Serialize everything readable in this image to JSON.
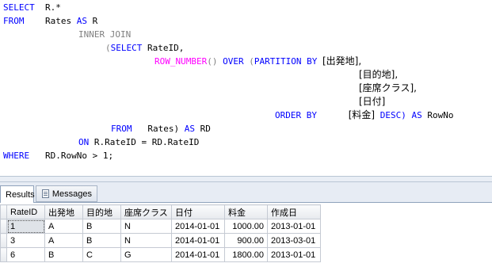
{
  "query": {
    "select_kw": "SELECT",
    "select_expr": "R.*",
    "from_kw": "FROM",
    "from_table": "Rates",
    "as_kw": "AS",
    "alias_r": "R",
    "inner_join": "INNER JOIN",
    "open_paren": "(",
    "select2_kw": "SELECT",
    "rateid_col": "RateID,",
    "row_number_fn": "ROW_NUMBER",
    "fn_parens": "()",
    "over_kw": "OVER",
    "partition_by_kw": "PARTITION BY",
    "partition_cols": [
      "[出発地],",
      "[目的地],",
      "[座席クラス],",
      "[日付]"
    ],
    "order_by_kw": "ORDER BY",
    "order_col": "[料金]",
    "desc_kw": "DESC)",
    "as2_kw": "AS",
    "rowno_alias": "RowNo",
    "from2_kw": "FROM",
    "rates2_table": "Rates)",
    "as3_kw": "AS",
    "rd_alias": "RD",
    "on_kw": "ON",
    "on_expr": "R.RateID = RD.RateID",
    "where_kw": "WHERE",
    "where_expr": "RD.RowNo > 1;"
  },
  "tabs": {
    "results_label": "Results",
    "messages_label": "Messages",
    "messages_icon": "messages-icon"
  },
  "grid": {
    "columns": [
      "RateID",
      "出発地",
      "目的地",
      "座席クラス",
      "日付",
      "料金",
      "作成日"
    ],
    "rows": [
      {
        "rownum": "",
        "cells": [
          "1",
          "A",
          "B",
          "N",
          "2014-01-01",
          "1000.00",
          "2013-01-01"
        ]
      },
      {
        "rownum": "",
        "cells": [
          "3",
          "A",
          "B",
          "N",
          "2014-01-01",
          "900.00",
          "2013-03-01"
        ]
      },
      {
        "rownum": "",
        "cells": [
          "6",
          "B",
          "C",
          "G",
          "2014-01-01",
          "1800.00",
          "2013-01-01"
        ]
      }
    ]
  },
  "colors": {
    "keyword": "#0000ff",
    "function": "#ff00ff",
    "operator": "#808080",
    "identifier": "#000000"
  }
}
